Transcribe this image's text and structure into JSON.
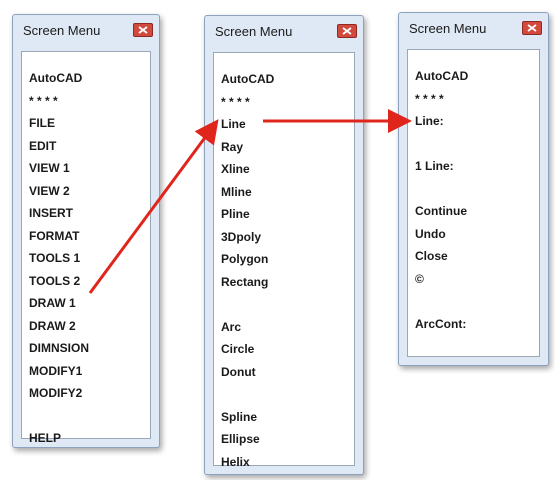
{
  "panels": [
    {
      "title": "Screen Menu",
      "items": [
        "AutoCAD",
        "* * * *",
        "FILE",
        "EDIT",
        "VIEW 1",
        "VIEW 2",
        "INSERT",
        "FORMAT",
        "TOOLS 1",
        "TOOLS 2",
        "DRAW 1",
        "DRAW 2",
        "DIMNSION",
        "MODIFY1",
        "MODIFY2",
        "",
        "HELP"
      ]
    },
    {
      "title": "Screen Menu",
      "items": [
        "AutoCAD",
        "* * * *",
        "Line",
        "Ray",
        "Xline",
        "Mline",
        "Pline",
        "3Dpoly",
        "Polygon",
        "Rectang",
        "",
        "Arc",
        "Circle",
        "Donut",
        "",
        "Spline",
        "Ellipse",
        "Helix"
      ]
    },
    {
      "title": "Screen Menu",
      "items": [
        "AutoCAD",
        "* * * *",
        "Line:",
        "",
        "1 Line:",
        "",
        "Continue",
        "Undo",
        "Close",
        "©",
        "",
        "ArcCont:"
      ]
    }
  ],
  "colors": {
    "arrow": "#e0261c",
    "close_button": "#d24a3e"
  },
  "icons": {
    "close": "close-icon"
  }
}
